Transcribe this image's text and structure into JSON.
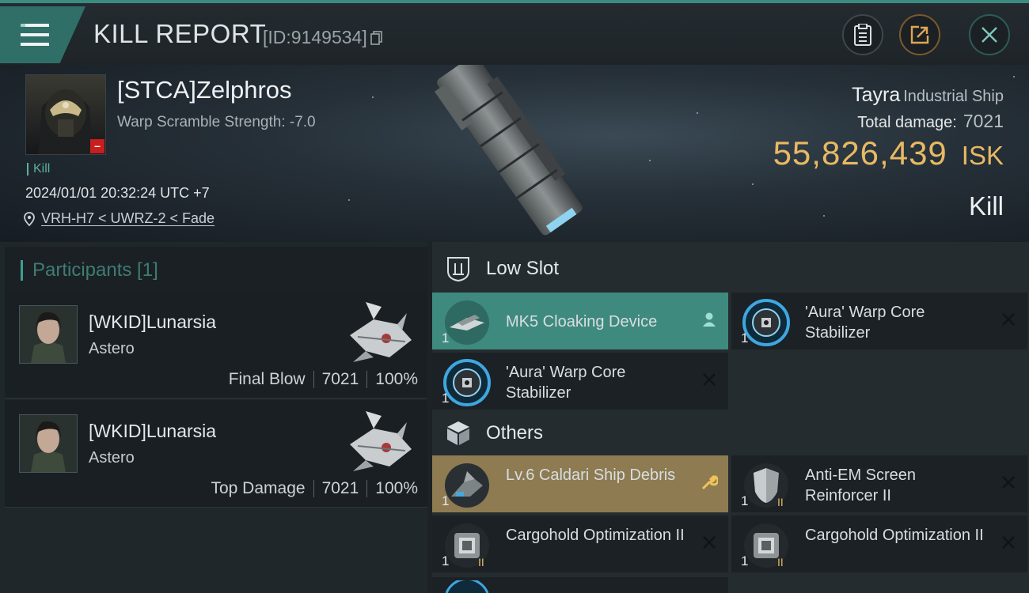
{
  "header": {
    "title": "KILL REPORT",
    "report_id": "[ID:9149534]",
    "icons": [
      "menu-icon",
      "copy-icon",
      "clipboard-icon",
      "share-icon",
      "close-icon"
    ]
  },
  "victim": {
    "name": "[STCA]Zelphros",
    "warp_scramble": "Warp Scramble Strength: -7.0",
    "badge": "–",
    "kill_tag": "Kill",
    "datetime": "2024/01/01 20:32:24 UTC +7",
    "location": "VRH-H7 < UWRZ-2 < Fade"
  },
  "ship": {
    "name": "Tayra",
    "class": "Industrial Ship",
    "total_damage_label": "Total damage:",
    "total_damage": "7021",
    "isk_value": "55,826,439",
    "isk_unit": "ISK",
    "result": "Kill"
  },
  "participants": {
    "header": "Participants [1]",
    "list": [
      {
        "name": "[WKID]Lunarsia",
        "ship": "Astero",
        "role": "Final Blow",
        "damage": "7021",
        "percent": "100%"
      },
      {
        "name": "[WKID]Lunarsia",
        "ship": "Astero",
        "role": "Top Damage",
        "damage": "7021",
        "percent": "100%"
      }
    ]
  },
  "sections": {
    "low_slot": "Low Slot",
    "others": "Others"
  },
  "items": [
    {
      "name": "MK5 Cloaking Device",
      "qty": "1",
      "status": "person-icon"
    },
    {
      "name": "'Aura' Warp Core Stabilizer",
      "qty": "1",
      "status": "x-icon"
    },
    {
      "name": "'Aura' Warp Core Stabilizer",
      "qty": "1",
      "status": "x-icon"
    },
    {
      "name": "Lv.6 Caldari Ship Debris",
      "qty": "1",
      "status": "wrench-icon"
    },
    {
      "name": "Anti-EM Screen Reinforcer II",
      "qty": "1",
      "status": "x-icon"
    },
    {
      "name": "Cargohold Optimization II",
      "qty": "1",
      "status": "x-icon"
    },
    {
      "name": "Cargohold Optimization II",
      "qty": "1",
      "status": "x-icon"
    }
  ],
  "colors": {
    "accent": "#3f8a7f",
    "isk": "#e8b964",
    "destroyed_item": "#3f8a7f",
    "dropped_item": "#8e7b52"
  }
}
